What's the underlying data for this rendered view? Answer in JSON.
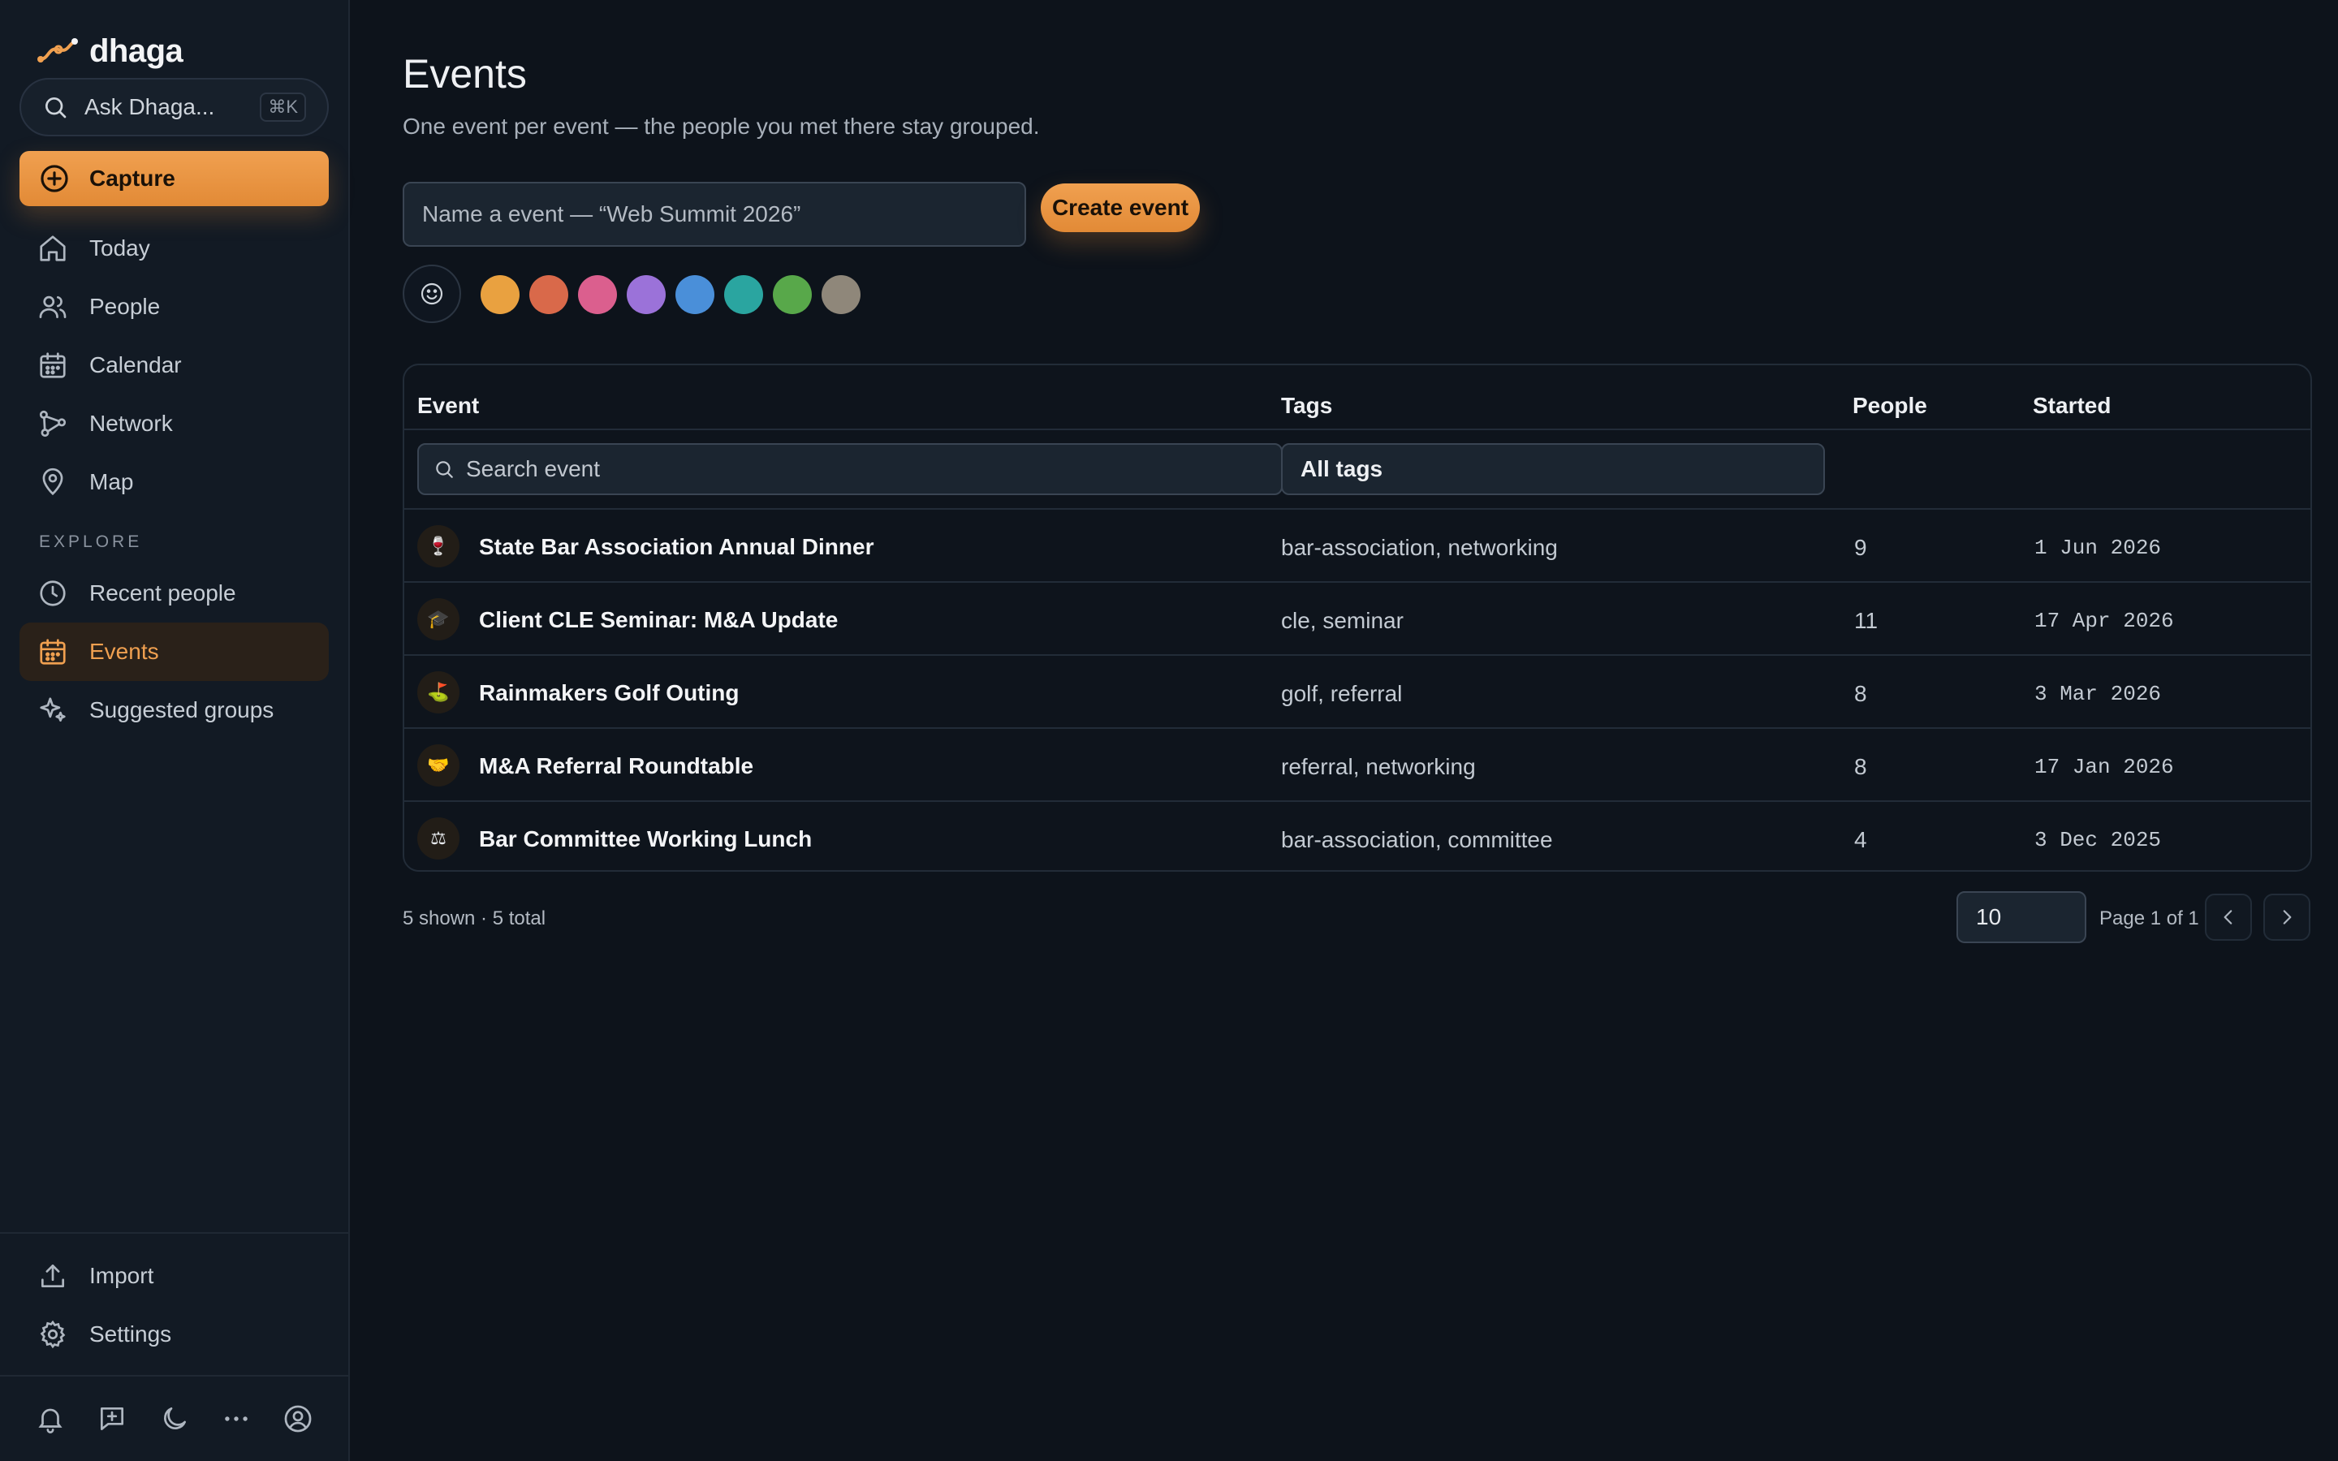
{
  "app": {
    "name": "dhaga",
    "accent": "#f0a050"
  },
  "sidebar": {
    "ask": {
      "label": "Ask Dhaga...",
      "shortcut": "⌘K"
    },
    "capture_label": "Capture",
    "items": [
      {
        "label": "Today",
        "icon": "home-icon"
      },
      {
        "label": "People",
        "icon": "people-icon"
      },
      {
        "label": "Calendar",
        "icon": "calendar-icon"
      },
      {
        "label": "Network",
        "icon": "network-icon"
      },
      {
        "label": "Map",
        "icon": "map-pin-icon"
      }
    ],
    "explore_label": "EXPLORE",
    "explore_items": [
      {
        "label": "Recent people",
        "icon": "clock-icon"
      },
      {
        "label": "Events",
        "icon": "calendar-icon",
        "active": true
      },
      {
        "label": "Suggested groups",
        "icon": "sparkle-icon"
      }
    ],
    "bottom_items": [
      {
        "label": "Import",
        "icon": "upload-icon"
      },
      {
        "label": "Settings",
        "icon": "gear-icon"
      }
    ],
    "footer_icons": [
      "bell-icon",
      "message-plus-icon",
      "moon-icon",
      "more-icon",
      "user-circle-icon"
    ]
  },
  "main": {
    "title": "Events",
    "subtitle": "One event per event — the people you met there stay grouped.",
    "new_event": {
      "placeholder": "Name a event — “Web Summit 2026”",
      "create_label": "Create event",
      "colors": [
        "#e9a140",
        "#d9694a",
        "#db5f8e",
        "#9b72d9",
        "#4a8fd9",
        "#2aa5a0",
        "#58a84a",
        "#8f877a"
      ]
    },
    "table": {
      "columns": {
        "event": "Event",
        "tags": "Tags",
        "people": "People",
        "started": "Started"
      },
      "search_placeholder": "Search event",
      "tags_filter": "All tags",
      "rows": [
        {
          "icon": "🍷",
          "name": "State Bar Association Annual Dinner",
          "tags": "bar-association, networking",
          "people": "9",
          "started": "1 Jun 2026"
        },
        {
          "icon": "🎓",
          "name": "Client CLE Seminar: M&A Update",
          "tags": "cle, seminar",
          "people": "11",
          "started": "17 Apr 2026"
        },
        {
          "icon": "⛳",
          "name": "Rainmakers Golf Outing",
          "tags": "golf, referral",
          "people": "8",
          "started": "3 Mar 2026"
        },
        {
          "icon": "🤝",
          "name": "M&A Referral Roundtable",
          "tags": "referral, networking",
          "people": "8",
          "started": "17 Jan 2026"
        },
        {
          "icon": "⚖",
          "name": "Bar Committee Working Lunch",
          "tags": "bar-association, committee",
          "people": "4",
          "started": "3 Dec 2025"
        }
      ]
    },
    "pagination": {
      "shown_text": "5 shown · 5 total",
      "per_page": "10",
      "page_text": "Page 1 of 1"
    }
  }
}
